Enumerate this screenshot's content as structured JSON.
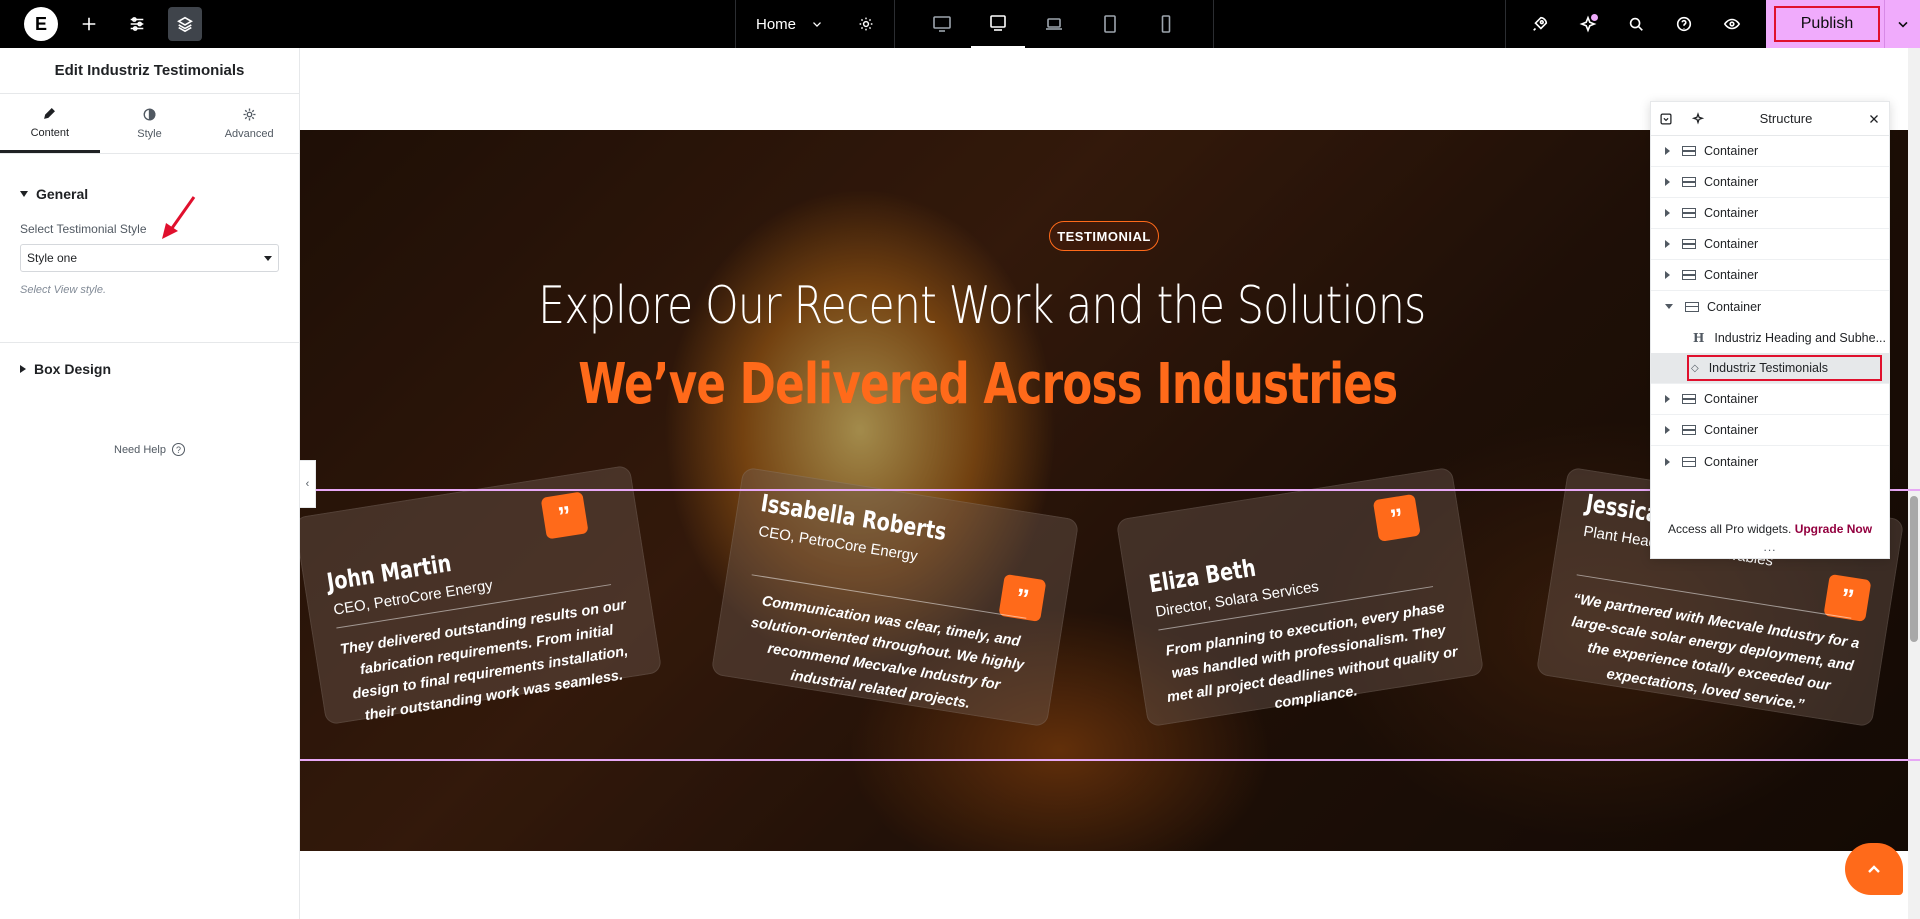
{
  "topbar": {
    "logo": "E",
    "page_name": "Home",
    "publish_label": "Publish"
  },
  "panel": {
    "title": "Edit Industriz Testimonials",
    "tabs": [
      {
        "label": "Content",
        "icon": "pencil-icon",
        "active": true
      },
      {
        "label": "Style",
        "icon": "half-circle-icon",
        "active": false
      },
      {
        "label": "Advanced",
        "icon": "gear-icon",
        "active": false
      }
    ],
    "general_section": "General",
    "testimonial_style_label": "Select Testimonial Style",
    "testimonial_style_value": "Style one",
    "testimonial_style_desc": "Select View style.",
    "box_design_section": "Box Design",
    "need_help": "Need Help"
  },
  "hero": {
    "badge": "TESTIMONIAL",
    "heading_line1": "Explore Our Recent Work and the Solutions",
    "heading_line2": "We’ve Delivered Across Industries",
    "quote_mark": "”",
    "cards": [
      {
        "name": "John Martin",
        "role": "CEO, PetroCore Energy",
        "quote": "They delivered outstanding results on our fabrication requirements. From initial design to final requirements installation, their outstanding work was seamless."
      },
      {
        "name": "Issabella Roberts",
        "role": "CEO, PetroCore Energy",
        "quote": "Communication was clear, timely, and solution-oriented throughout. We highly recommend Mecvalve Industry for industrial related projects."
      },
      {
        "name": "Eliza Beth",
        "role": "Director, Solara Services",
        "quote": "From planning to execution, every phase was handled with professionalism. They met all project deadlines without quality or compliance."
      },
      {
        "name": "Jessica",
        "role": "Plant Head, HG Renewables",
        "quote": "“We partnered with Mecvale Industry for a large-scale solar energy deployment, and the experience totally exceeded our expectations, loved service.”"
      }
    ]
  },
  "structure": {
    "title": "Structure",
    "items": [
      {
        "label": "Container"
      },
      {
        "label": "Container"
      },
      {
        "label": "Container"
      },
      {
        "label": "Container"
      },
      {
        "label": "Container"
      },
      {
        "label": "Container"
      },
      {
        "label": "Industriz Heading and Subhe..."
      },
      {
        "label": "Industriz Testimonials"
      },
      {
        "label": "Container"
      },
      {
        "label": "Container"
      },
      {
        "label": "Container"
      }
    ],
    "footer_text": "Access all Pro widgets.",
    "upgrade_link": "Upgrade Now",
    "more": "..."
  },
  "colors": {
    "accent_orange": "#ff6a1a",
    "publish_bg": "#f0abfc",
    "highlight_red": "#e0102d",
    "upgrade_link": "#93003f"
  }
}
